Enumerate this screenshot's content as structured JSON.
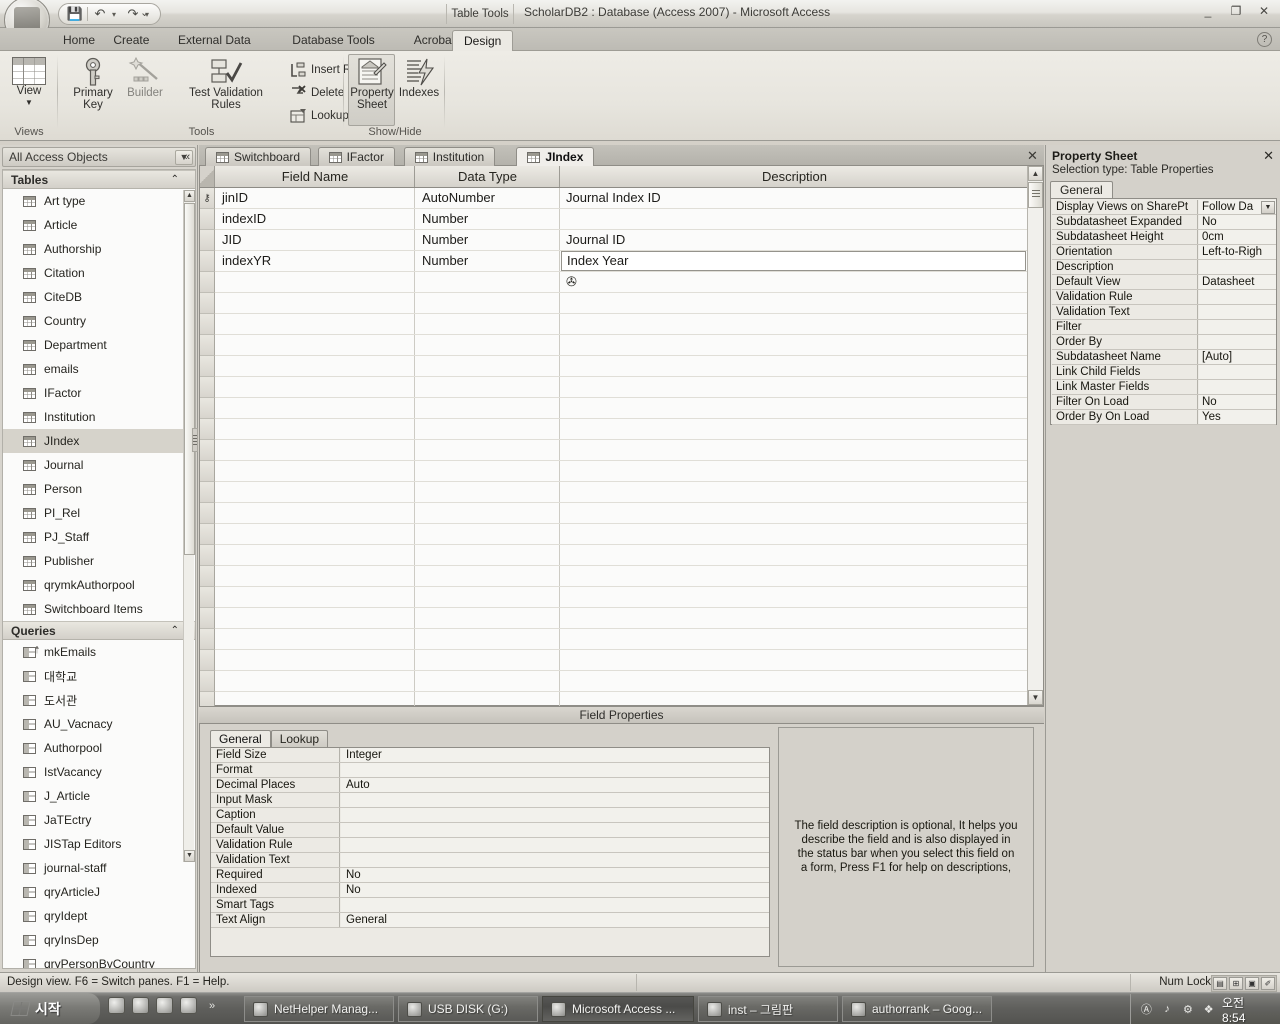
{
  "window": {
    "table_tools_label": "Table Tools",
    "title": "ScholarDB2 : Database (Access 2007) - Microsoft Access",
    "minimize": "_",
    "restore": "❐",
    "close": "✕",
    "help": "?"
  },
  "qat": {
    "save": "💾",
    "undo": "↶",
    "redo": "↷",
    "customize": "⌄"
  },
  "ribbon_tabs": [
    {
      "label": "Home",
      "active": false
    },
    {
      "label": "Create",
      "active": false
    },
    {
      "label": "External Data",
      "active": false
    },
    {
      "label": "Database Tools",
      "active": false
    },
    {
      "label": "Acrobat",
      "active": false
    },
    {
      "label": "Design",
      "active": true
    }
  ],
  "ribbon": {
    "groups": [
      {
        "label": "Views"
      },
      {
        "label": "Tools"
      },
      {
        "label": "Show/Hide"
      }
    ],
    "view_button": "View",
    "view_arrow": "▼",
    "primary_key": "Primary\nKey",
    "primary_key_l1": "Primary",
    "primary_key_l2": "Key",
    "builder": "Builder",
    "test_validation_l1": "Test Validation",
    "test_validation_l2": "Rules",
    "insert_rows": "Insert Rows",
    "delete_rows": "Delete Rows",
    "lookup_column": "Lookup Column",
    "property_sheet_l1": "Property",
    "property_sheet_l2": "Sheet",
    "indexes": "Indexes"
  },
  "navpane": {
    "title": "All Access Objects",
    "dropdown_caret": "▼",
    "collapse": "«",
    "groups": [
      {
        "label": "Tables",
        "chevron": "⌃",
        "items": [
          {
            "label": "Art type",
            "icon": "table-icon",
            "selected": false
          },
          {
            "label": "Article",
            "icon": "table-icon",
            "selected": false
          },
          {
            "label": "Authorship",
            "icon": "table-icon",
            "selected": false
          },
          {
            "label": "Citation",
            "icon": "table-icon",
            "selected": false
          },
          {
            "label": "CiteDB",
            "icon": "table-icon",
            "selected": false
          },
          {
            "label": "Country",
            "icon": "table-icon",
            "selected": false
          },
          {
            "label": "Department",
            "icon": "table-icon",
            "selected": false
          },
          {
            "label": "emails",
            "icon": "table-icon",
            "selected": false
          },
          {
            "label": "IFactor",
            "icon": "table-icon",
            "selected": false
          },
          {
            "label": "Institution",
            "icon": "table-icon",
            "selected": false
          },
          {
            "label": "JIndex",
            "icon": "table-icon",
            "selected": true
          },
          {
            "label": "Journal",
            "icon": "table-icon",
            "selected": false
          },
          {
            "label": "Person",
            "icon": "table-icon",
            "selected": false
          },
          {
            "label": "PI_Rel",
            "icon": "table-icon",
            "selected": false
          },
          {
            "label": "PJ_Staff",
            "icon": "table-icon",
            "selected": false
          },
          {
            "label": "Publisher",
            "icon": "table-icon",
            "selected": false
          },
          {
            "label": "qrymkAuthorpool",
            "icon": "table-icon",
            "selected": false
          },
          {
            "label": "Switchboard Items",
            "icon": "table-icon",
            "selected": false
          }
        ]
      },
      {
        "label": "Queries",
        "chevron": "⌃",
        "items": [
          {
            "label": "mkEmails",
            "icon": "query-special-icon",
            "selected": false
          },
          {
            "label": "대학교",
            "icon": "query-icon",
            "selected": false
          },
          {
            "label": "도서관",
            "icon": "query-icon",
            "selected": false
          },
          {
            "label": "AU_Vacnacy",
            "icon": "query-icon",
            "selected": false
          },
          {
            "label": "Authorpool",
            "icon": "query-icon",
            "selected": false
          },
          {
            "label": "IstVacancy",
            "icon": "query-icon",
            "selected": false
          },
          {
            "label": "J_Article",
            "icon": "query-icon",
            "selected": false
          },
          {
            "label": "JaTEctry",
            "icon": "query-icon",
            "selected": false
          },
          {
            "label": "JISTap Editors",
            "icon": "query-icon",
            "selected": false
          },
          {
            "label": "journal-staff",
            "icon": "query-icon",
            "selected": false
          },
          {
            "label": "qryArticleJ",
            "icon": "query-icon",
            "selected": false
          },
          {
            "label": "qryIdept",
            "icon": "query-icon",
            "selected": false
          },
          {
            "label": "qryInsDep",
            "icon": "query-icon",
            "selected": false
          },
          {
            "label": "qryPersonByCountry",
            "icon": "query-icon",
            "selected": false
          }
        ]
      }
    ],
    "scroll_up": "▲",
    "scroll_down": "▼"
  },
  "doc_tabs": [
    {
      "label": "Switchboard",
      "icon": "form-icon",
      "active": false
    },
    {
      "label": "IFactor",
      "icon": "table-icon",
      "active": false
    },
    {
      "label": "Institution",
      "icon": "table-icon",
      "active": false
    },
    {
      "label": "JIndex",
      "icon": "table-icon",
      "active": true
    }
  ],
  "doc_tab_close": "✕",
  "grid": {
    "headers": [
      "Field Name",
      "Data Type",
      "Description"
    ],
    "rows": [
      {
        "key": true,
        "field": "jinID",
        "type": "AutoNumber",
        "desc": "Journal Index ID",
        "desc_active": false
      },
      {
        "key": false,
        "field": "indexID",
        "type": "Number",
        "desc": "",
        "desc_active": false
      },
      {
        "key": false,
        "field": "JID",
        "type": "Number",
        "desc": "Journal ID",
        "desc_active": false
      },
      {
        "key": false,
        "field": "indexYR",
        "type": "Number",
        "desc": "Index Year",
        "desc_active": true
      },
      {
        "key": false,
        "field": "",
        "type": "",
        "desc": "",
        "desc_active": false,
        "caret": true
      }
    ],
    "key_glyph": "⚷",
    "caret_glyph": "✇",
    "scroll_up": "▲",
    "scroll_down": "▼"
  },
  "field_properties": {
    "bar_label": "Field Properties",
    "tabs": [
      {
        "label": "General",
        "active": true
      },
      {
        "label": "Lookup",
        "active": false
      }
    ],
    "rows": [
      {
        "name": "Field Size",
        "value": "Integer"
      },
      {
        "name": "Format",
        "value": ""
      },
      {
        "name": "Decimal Places",
        "value": "Auto"
      },
      {
        "name": "Input Mask",
        "value": ""
      },
      {
        "name": "Caption",
        "value": ""
      },
      {
        "name": "Default Value",
        "value": ""
      },
      {
        "name": "Validation Rule",
        "value": ""
      },
      {
        "name": "Validation Text",
        "value": ""
      },
      {
        "name": "Required",
        "value": "No"
      },
      {
        "name": "Indexed",
        "value": "No"
      },
      {
        "name": "Smart Tags",
        "value": ""
      },
      {
        "name": "Text Align",
        "value": "General"
      }
    ],
    "help_text": "The field description is optional,  It helps you describe the field and is also displayed in the status bar when you select this field on a form,  Press F1 for help on descriptions,"
  },
  "property_sheet": {
    "title": "Property Sheet",
    "close": "✕",
    "selection_type": "Selection type:  Table Properties",
    "tabs": [
      {
        "label": "General",
        "active": true
      }
    ],
    "dropdown_caret": "▼",
    "rows": [
      {
        "name": "Display Views on SharePt",
        "value": "Follow Da",
        "has_dropdown": true
      },
      {
        "name": "Subdatasheet Expanded",
        "value": "No",
        "has_dropdown": false
      },
      {
        "name": "Subdatasheet Height",
        "value": "0cm",
        "has_dropdown": false
      },
      {
        "name": "Orientation",
        "value": "Left-to-Righ",
        "has_dropdown": false
      },
      {
        "name": "Description",
        "value": "",
        "has_dropdown": false
      },
      {
        "name": "Default View",
        "value": "Datasheet",
        "has_dropdown": false
      },
      {
        "name": "Validation Rule",
        "value": "",
        "has_dropdown": false
      },
      {
        "name": "Validation Text",
        "value": "",
        "has_dropdown": false
      },
      {
        "name": "Filter",
        "value": "",
        "has_dropdown": false
      },
      {
        "name": "Order By",
        "value": "",
        "has_dropdown": false
      },
      {
        "name": "Subdatasheet Name",
        "value": "[Auto]",
        "has_dropdown": false
      },
      {
        "name": "Link Child Fields",
        "value": "",
        "has_dropdown": false
      },
      {
        "name": "Link Master Fields",
        "value": "",
        "has_dropdown": false
      },
      {
        "name": "Filter On Load",
        "value": "No",
        "has_dropdown": false
      },
      {
        "name": "Order By On Load",
        "value": "Yes",
        "has_dropdown": false
      }
    ]
  },
  "statusbar": {
    "message": "Design view.  F6 = Switch panes.  F1 = Help.",
    "numlock": "Num Lock",
    "view_buttons": [
      "▤",
      "⊞",
      "▣",
      "✐"
    ]
  },
  "taskbar": {
    "start_label": "시작",
    "quicklaunch_overflow": "»",
    "buttons": [
      {
        "label": "NetHelper Manag...",
        "active": false
      },
      {
        "label": "USB DISK (G:)",
        "active": false
      },
      {
        "label": "Microsoft Access ...",
        "active": true
      },
      {
        "label": "inst – 그림판",
        "active": false
      },
      {
        "label": "authorrank – Goog...",
        "active": false
      }
    ],
    "tray_icons": [
      "Ⓐ",
      "♪",
      "⚙",
      "❖"
    ],
    "clock": "오전 8:54"
  }
}
